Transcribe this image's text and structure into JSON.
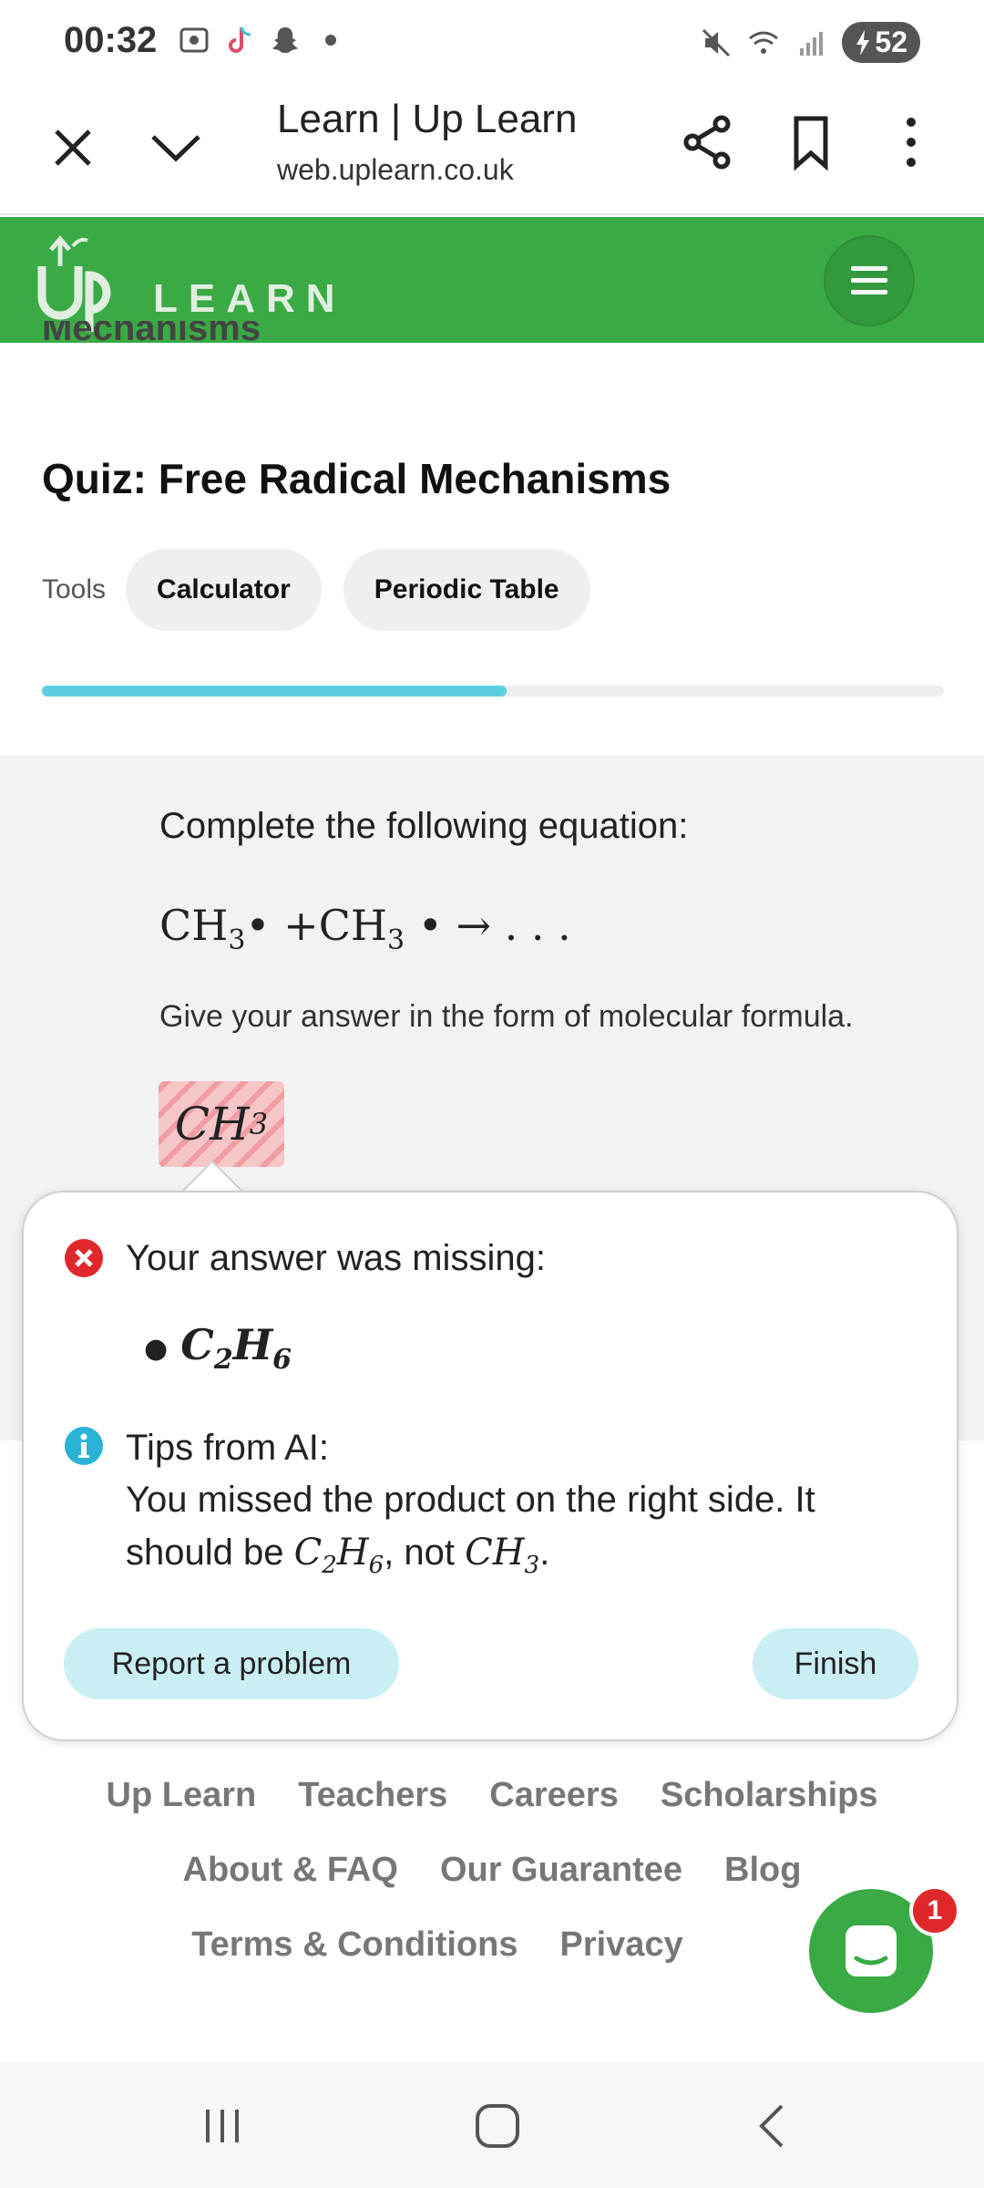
{
  "status_bar": {
    "time": "00:32",
    "battery": "52"
  },
  "browser": {
    "title": "Learn | Up Learn",
    "url": "web.uplearn.co.uk"
  },
  "header": {
    "logo_text": "LEARN"
  },
  "page": {
    "cut_title": "Mechanisms",
    "quiz_title": "Quiz: Free Radical Mechanisms",
    "tools_label": "Tools",
    "tools": [
      "Calculator",
      "Periodic Table"
    ],
    "progress": 0.515
  },
  "question": {
    "prompt": "Complete the following equation:",
    "equation": {
      "a": "CH",
      "a_sub": "3",
      "op": "+",
      "b": "CH",
      "b_sub": "3",
      "tail": "→ . . ."
    },
    "instruction": "Give your answer in the form of molecular formula.",
    "answer": {
      "main": "CH",
      "sub": "3"
    }
  },
  "feedback": {
    "missing_label": "Your answer was missing:",
    "missing_item": {
      "c": "C",
      "c_sub": "2",
      "h": "H",
      "h_sub": "6"
    },
    "tips_label": "Tips from AI:",
    "tips_line1": "You missed the product on the right side. It",
    "tips_line2_start": "should be ",
    "tips_formula1": {
      "c": "C",
      "c_sub": "2",
      "h": "H",
      "h_sub": "6"
    },
    "tips_line2_mid": ", not ",
    "tips_formula2": {
      "c": "CH",
      "c_sub": "3"
    },
    "tips_line2_end": ".",
    "report_label": "Report a problem",
    "finish_label": "Finish"
  },
  "footer": {
    "row1": [
      "Up Learn",
      "Teachers",
      "Careers",
      "Scholarships"
    ],
    "row2": [
      "About & FAQ",
      "Our Guarantee",
      "Blog"
    ],
    "row3": [
      "Terms & Conditions",
      "Privacy"
    ]
  },
  "chat": {
    "badge": "1"
  },
  "colors": {
    "brand_green": "#3aaa45",
    "progress": "#5bcfe0",
    "error": "#e0282c",
    "info": "#2bb3d6",
    "button_bg": "#c9eef3"
  }
}
